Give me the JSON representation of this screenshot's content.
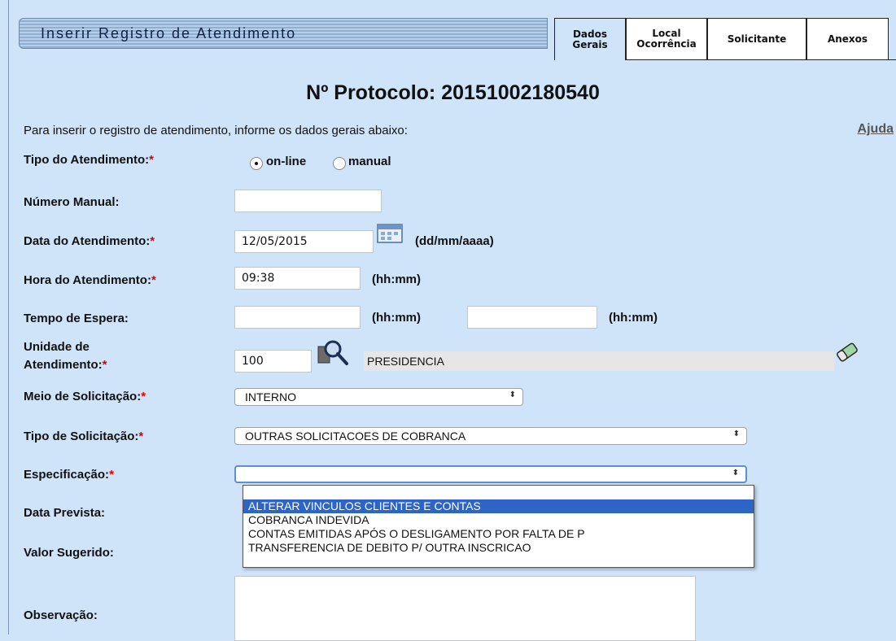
{
  "header": {
    "title": "Inserir Registro de Atendimento",
    "tabs": [
      {
        "label": "Dados\nGerais",
        "active": true
      },
      {
        "label": "Local\nOcorrência",
        "active": false
      },
      {
        "label": "Solicitante",
        "active": false
      },
      {
        "label": "Anexos",
        "active": false
      }
    ]
  },
  "protocol": "Nº Protocolo: 20151002180540",
  "intro": "Para inserir o registro de atendimento, informe os dados gerais abaixo:",
  "help": "Ajuda",
  "required_mark": "*",
  "fields": {
    "tipo_atendimento": {
      "label": "Tipo do Atendimento:",
      "options": [
        "on-line",
        "manual"
      ],
      "selected": "on-line"
    },
    "numero_manual": {
      "label": "Número Manual:",
      "value": ""
    },
    "data_atendimento": {
      "label": "Data do Atendimento:",
      "value": "12/05/2015",
      "format": "(dd/mm/aaaa)"
    },
    "hora_atendimento": {
      "label": "Hora do Atendimento:",
      "value": "09:38",
      "format": "(hh:mm)"
    },
    "tempo_espera": {
      "label": "Tempo de Espera:",
      "value1": "",
      "format1": "(hh:mm)",
      "value2": "",
      "format2": "(hh:mm)"
    },
    "unidade": {
      "label_line1": "Unidade de",
      "label_line2": "Atendimento:",
      "code": "100",
      "name": "PRESIDENCIA"
    },
    "meio_solicitacao": {
      "label": "Meio de Solicitação:",
      "selected": "INTERNO"
    },
    "tipo_solicitacao": {
      "label": "Tipo de Solicitação:",
      "selected": "OUTRAS SOLICITACOES DE COBRANCA"
    },
    "especificacao": {
      "label": "Especificação:",
      "selected": "",
      "options": [
        "",
        "ALTERAR VINCULOS CLIENTES E CONTAS",
        "COBRANCA INDEVIDA",
        "CONTAS EMITIDAS APÓS O DESLIGAMENTO POR FALTA DE P",
        "TRANSFERENCIA DE DEBITO P/ OUTRA INSCRICAO"
      ],
      "highlighted_index": 1
    },
    "data_prevista": {
      "label": "Data Prevista:"
    },
    "valor_sugerido": {
      "label": "Valor Sugerido:"
    },
    "observacao": {
      "label": "Observação:",
      "value": ""
    }
  },
  "colors": {
    "background": "#cfe4f8",
    "required": "#e00000",
    "highlight": "#2f64c7"
  }
}
